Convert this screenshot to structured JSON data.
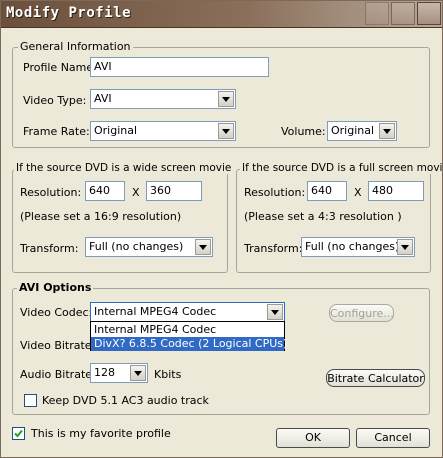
{
  "window": {
    "title": "Modify Profile"
  },
  "general": {
    "legend": "General Information",
    "profile_name_label": "Profile Name:",
    "profile_name_value": "AVI",
    "video_type_label": "Video Type:",
    "video_type_value": "AVI",
    "frame_rate_label": "Frame Rate:",
    "frame_rate_value": "Original",
    "volume_label": "Volume:",
    "volume_value": "Original"
  },
  "wide": {
    "legend": "If the source DVD is a wide screen movie",
    "resolution_label": "Resolution:",
    "width": "640",
    "times": "X",
    "height": "360",
    "hint": "(Please set a 16:9 resolution)",
    "transform_label": "Transform:",
    "transform_value": "Full (no changes)"
  },
  "full": {
    "legend": "If the source DVD is a full screen movie",
    "resolution_label": "Resolution:",
    "width": "640",
    "times": "X",
    "height": "480",
    "hint": "(Please set a 4:3 resolution )",
    "transform_label": "Transform:",
    "transform_value": "Full (no changes)"
  },
  "avi": {
    "legend": "AVI Options",
    "video_codec_label": "Video Codec:",
    "video_codec_value": "Internal MPEG4 Codec",
    "codec_options": [
      "Internal MPEG4 Codec",
      "DivX? 6.8.5 Codec (2 Logical CPUs)"
    ],
    "configure_label": "Configure...",
    "video_bitrate_label": "Video Bitrate:",
    "audio_bitrate_label": "Audio Bitrate:",
    "audio_bitrate_value": "128",
    "kbits_label": "Kbits",
    "bitrate_calc_label": "Bitrate Calculator",
    "keep_ac3_label": "Keep DVD 5.1 AC3 audio track"
  },
  "footer": {
    "favorite_label": "This is my favorite profile",
    "favorite_checked": true,
    "ok_label": "OK",
    "cancel_label": "Cancel"
  }
}
